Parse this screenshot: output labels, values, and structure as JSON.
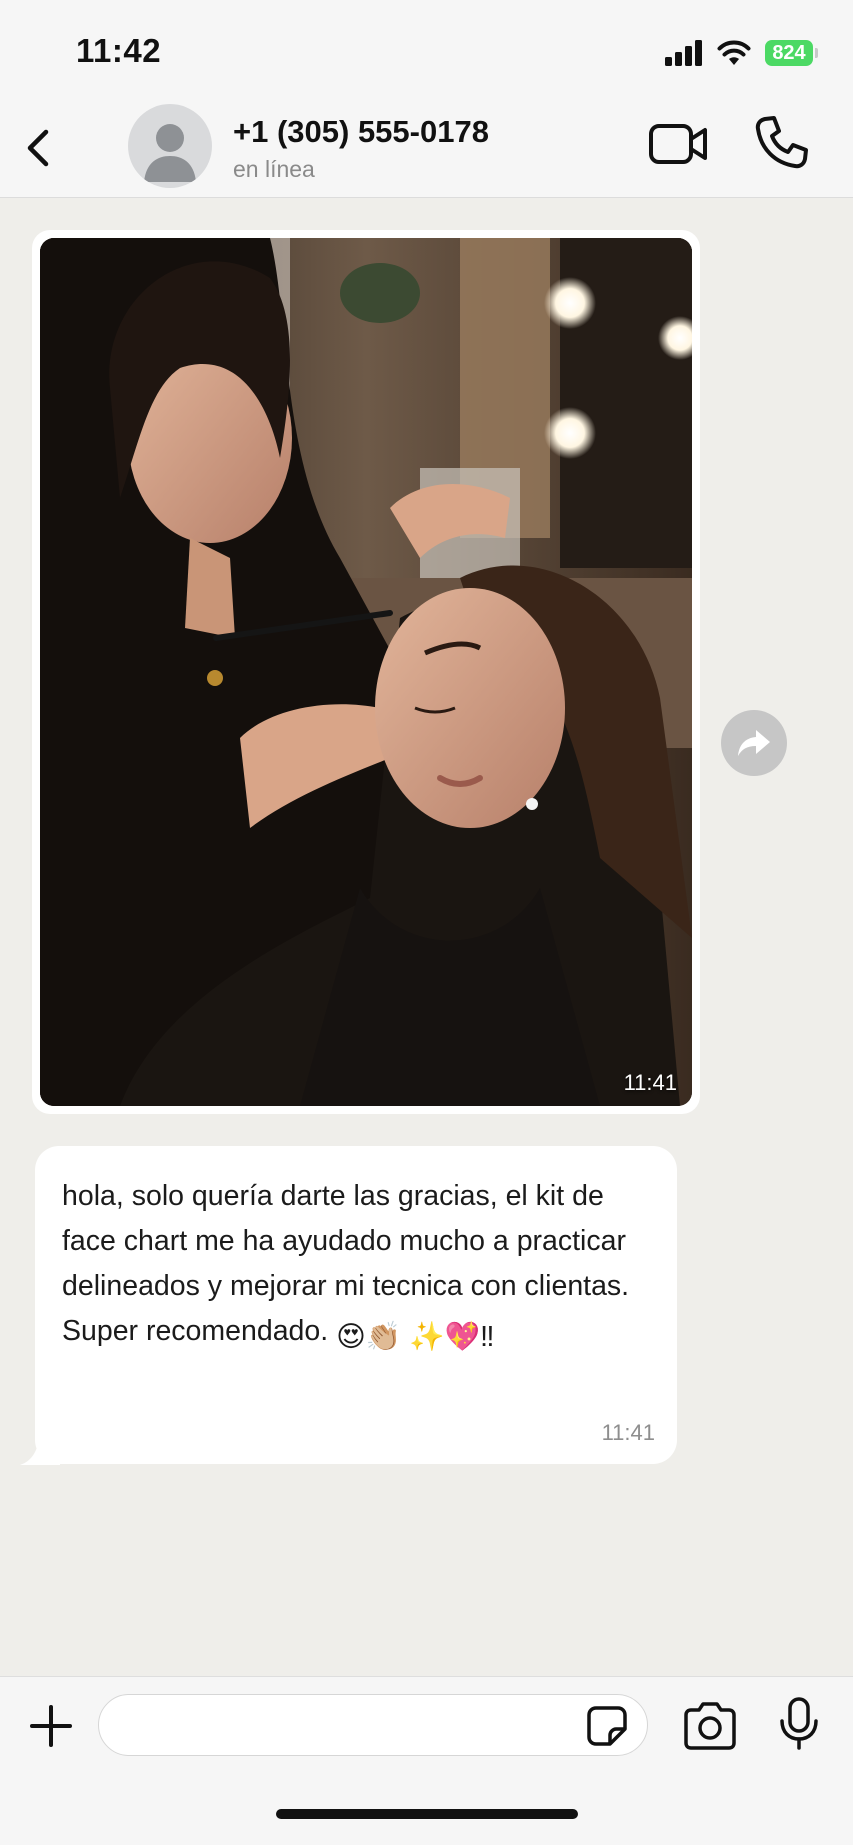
{
  "status_bar": {
    "time": "11:42",
    "battery": "824",
    "icons": [
      "signal-icon",
      "wifi-icon",
      "battery-icon"
    ]
  },
  "header": {
    "contact_name": "+1 (305) 555-0178",
    "contact_status": "en línea",
    "icons": [
      "back-chevron-icon",
      "avatar-placeholder-icon",
      "video-call-icon",
      "phone-call-icon"
    ]
  },
  "messages": [
    {
      "type": "image",
      "alt": "Maquilladora aplicando delineador a una clienta en un estudio de maquillaje",
      "time": "11:41",
      "action_icon": "forward-arrow-icon"
    },
    {
      "type": "text",
      "text": "hola, solo quería darte las gracias, el kit de face chart me ha ayudado mucho a practicar delineados y mejorar mi tecnica con clientas. Super recomendado.",
      "emoji_line": "😍👏🏼 ✨💖‼",
      "time": "11:41"
    }
  ],
  "composer": {
    "input_value": "",
    "icons": [
      "plus-icon",
      "sticker-icon",
      "camera-icon",
      "microphone-icon"
    ]
  },
  "colors": {
    "chat_background": "#efeeea",
    "bubble": "#ffffff",
    "battery_green": "#4cd964",
    "bar_background": "#f6f6f6"
  }
}
